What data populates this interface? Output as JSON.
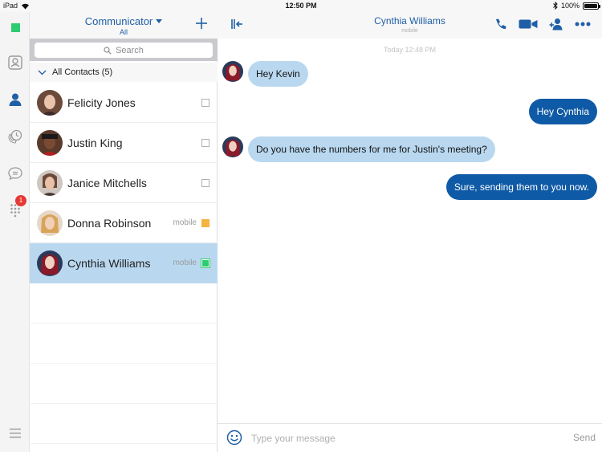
{
  "statusbar": {
    "device": "iPad",
    "time": "12:50 PM",
    "battery": "100%",
    "battery_level": 1.0
  },
  "rail": {
    "badge": "1"
  },
  "contacts_panel": {
    "title": "Communicator",
    "subtitle": "All",
    "search_placeholder": "Search",
    "group_label": "All Contacts (5)",
    "contacts": [
      {
        "name": "Felicity Jones",
        "status_label": "",
        "presence": "offline"
      },
      {
        "name": "Justin King",
        "status_label": "",
        "presence": "offline"
      },
      {
        "name": "Janice Mitchells",
        "status_label": "",
        "presence": "offline"
      },
      {
        "name": "Donna Robinson",
        "status_label": "mobile",
        "presence": "away"
      },
      {
        "name": "Cynthia Williams",
        "status_label": "mobile",
        "presence": "available"
      }
    ]
  },
  "chat": {
    "contact_name": "Cynthia Williams",
    "contact_sub": "mobile",
    "timestamp": "Today 12:48 PM",
    "messages": [
      {
        "direction": "in",
        "text": "Hey Kevin"
      },
      {
        "direction": "out",
        "text": "Hey Cynthia"
      },
      {
        "direction": "in",
        "text": "Do you have the numbers for me for Justin's meeting?"
      },
      {
        "direction": "out",
        "text": "Sure, sending them to you now."
      }
    ],
    "composer_placeholder": "Type your message",
    "send_label": "Send"
  },
  "colors": {
    "accent": "#1f5fa6",
    "outgoing_bubble": "#0f5aa6",
    "incoming_bubble": "#b9d8f0",
    "available": "#2ecc71",
    "away": "#f5b342",
    "badge": "#e53935"
  }
}
